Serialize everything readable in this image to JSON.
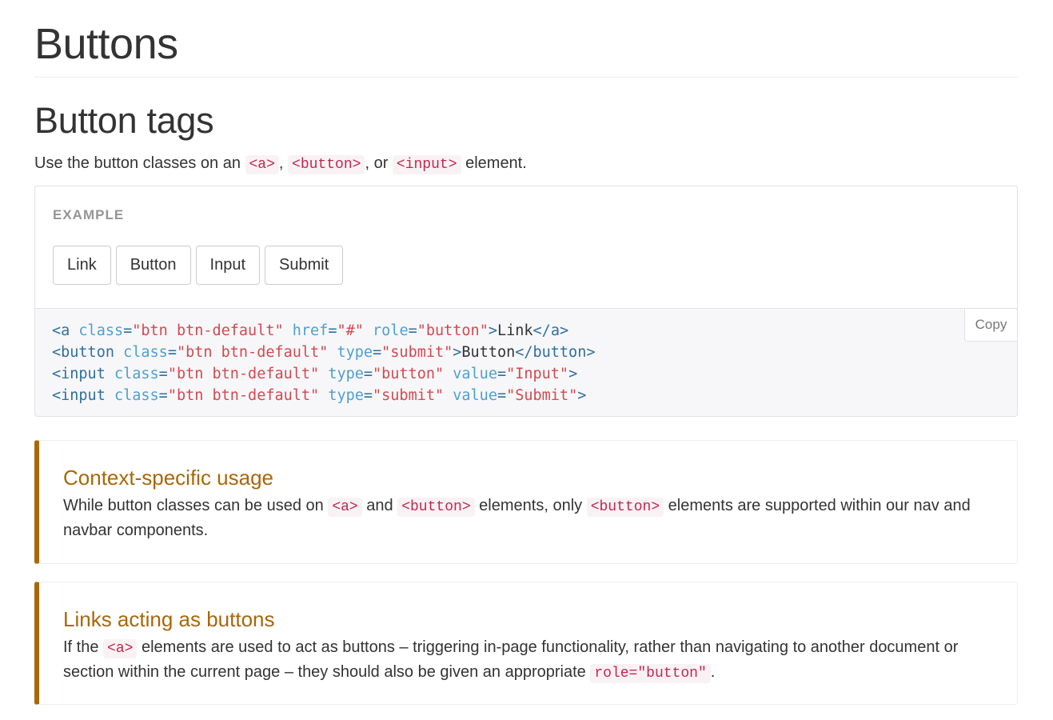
{
  "header": {
    "title": "Buttons"
  },
  "section": {
    "title": "Button tags",
    "lead": {
      "pre": "Use the button classes on an ",
      "code1": "<a>",
      "sep1": ", ",
      "code2": "<button>",
      "sep2": ", or ",
      "code3": "<input>",
      "post": " element."
    }
  },
  "example": {
    "label": "EXAMPLE",
    "buttons": [
      "Link",
      "Button",
      "Input",
      "Submit"
    ]
  },
  "code": {
    "copy_label": "Copy",
    "lines": [
      [
        [
          "tag",
          "<a"
        ],
        [
          "txt",
          " "
        ],
        [
          "attr",
          "class"
        ],
        [
          "tag",
          "="
        ],
        [
          "str",
          "\"btn btn-default\""
        ],
        [
          "txt",
          " "
        ],
        [
          "attr",
          "href"
        ],
        [
          "tag",
          "="
        ],
        [
          "str",
          "\"#\""
        ],
        [
          "txt",
          " "
        ],
        [
          "attr",
          "role"
        ],
        [
          "tag",
          "="
        ],
        [
          "str",
          "\"button\""
        ],
        [
          "tag",
          ">"
        ],
        [
          "txt",
          "Link"
        ],
        [
          "tag",
          "</a>"
        ]
      ],
      [
        [
          "tag",
          "<button"
        ],
        [
          "txt",
          " "
        ],
        [
          "attr",
          "class"
        ],
        [
          "tag",
          "="
        ],
        [
          "str",
          "\"btn btn-default\""
        ],
        [
          "txt",
          " "
        ],
        [
          "attr",
          "type"
        ],
        [
          "tag",
          "="
        ],
        [
          "str",
          "\"submit\""
        ],
        [
          "tag",
          ">"
        ],
        [
          "txt",
          "Button"
        ],
        [
          "tag",
          "</button>"
        ]
      ],
      [
        [
          "tag",
          "<input"
        ],
        [
          "txt",
          " "
        ],
        [
          "attr",
          "class"
        ],
        [
          "tag",
          "="
        ],
        [
          "str",
          "\"btn btn-default\""
        ],
        [
          "txt",
          " "
        ],
        [
          "attr",
          "type"
        ],
        [
          "tag",
          "="
        ],
        [
          "str",
          "\"button\""
        ],
        [
          "txt",
          " "
        ],
        [
          "attr",
          "value"
        ],
        [
          "tag",
          "="
        ],
        [
          "str",
          "\"Input\""
        ],
        [
          "tag",
          ">"
        ]
      ],
      [
        [
          "tag",
          "<input"
        ],
        [
          "txt",
          " "
        ],
        [
          "attr",
          "class"
        ],
        [
          "tag",
          "="
        ],
        [
          "str",
          "\"btn btn-default\""
        ],
        [
          "txt",
          " "
        ],
        [
          "attr",
          "type"
        ],
        [
          "tag",
          "="
        ],
        [
          "str",
          "\"submit\""
        ],
        [
          "txt",
          " "
        ],
        [
          "attr",
          "value"
        ],
        [
          "tag",
          "="
        ],
        [
          "str",
          "\"Submit\""
        ],
        [
          "tag",
          ">"
        ]
      ]
    ]
  },
  "callouts": [
    {
      "title": "Context-specific usage",
      "parts": [
        [
          "txt",
          "While button classes can be used on "
        ],
        [
          "code",
          "<a>"
        ],
        [
          "txt",
          " and "
        ],
        [
          "code",
          "<button>"
        ],
        [
          "txt",
          " elements, only "
        ],
        [
          "code",
          "<button>"
        ],
        [
          "txt",
          " elements are supported within our nav and navbar components."
        ]
      ]
    },
    {
      "title": "Links acting as buttons",
      "parts": [
        [
          "txt",
          "If the "
        ],
        [
          "code",
          "<a>"
        ],
        [
          "txt",
          " elements are used to act as buttons – triggering in-page functionality, rather than navigating to another document or section within the current page – they should also be given an appropriate "
        ],
        [
          "code",
          "role=\"button\""
        ],
        [
          "txt",
          "."
        ]
      ]
    }
  ],
  "colors": {
    "callout_warning": "#aa6708",
    "code_inline": "#c7254e",
    "code_bg": "#f7f7f9"
  }
}
